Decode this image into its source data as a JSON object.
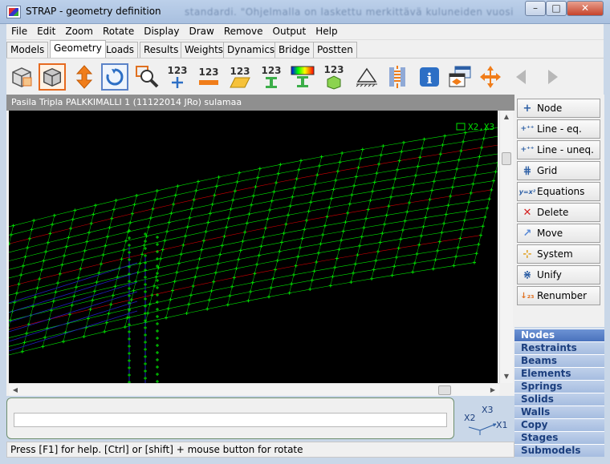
{
  "window": {
    "title": "STRAP - geometry definition",
    "background_title": "standardi. \"Ohjelmalla on laskettu merkittävä kuluneiden vuosien aikana\""
  },
  "menu": [
    "File",
    "Edit",
    "Zoom",
    "Rotate",
    "Display",
    "Draw",
    "Remove",
    "Output",
    "Help"
  ],
  "tabs": [
    "Models",
    "Geometry",
    "Loads",
    "Results",
    "Weights",
    "Dynamics",
    "Bridge",
    "Postten"
  ],
  "toolbar": {
    "num_label": "123"
  },
  "canvas": {
    "title": "Pasila Tripla PALKKIMALLI 1 (11122014 JRo) sulamaa",
    "node_label": "X2,X3"
  },
  "commands": [
    "Node",
    "Line - eq.",
    "Line - uneq.",
    "Grid",
    "Equations",
    "Delete",
    "Move",
    "System",
    "Unify",
    "Renumber"
  ],
  "categories": [
    "Nodes",
    "Restraints",
    "Beams",
    "Elements",
    "Springs",
    "Solids",
    "Walls",
    "Copy",
    "Stages",
    "Submodels"
  ],
  "axes": {
    "x1": "X1",
    "x2": "X2",
    "x3": "X3"
  },
  "status": "Press [F1] for help. [Ctrl] or [shift] + mouse button for rotate",
  "colors": {
    "mesh_green": "#00e000",
    "mesh_red": "#d00000",
    "mesh_blue": "#2020c0",
    "active_category": "#4a72bd"
  }
}
